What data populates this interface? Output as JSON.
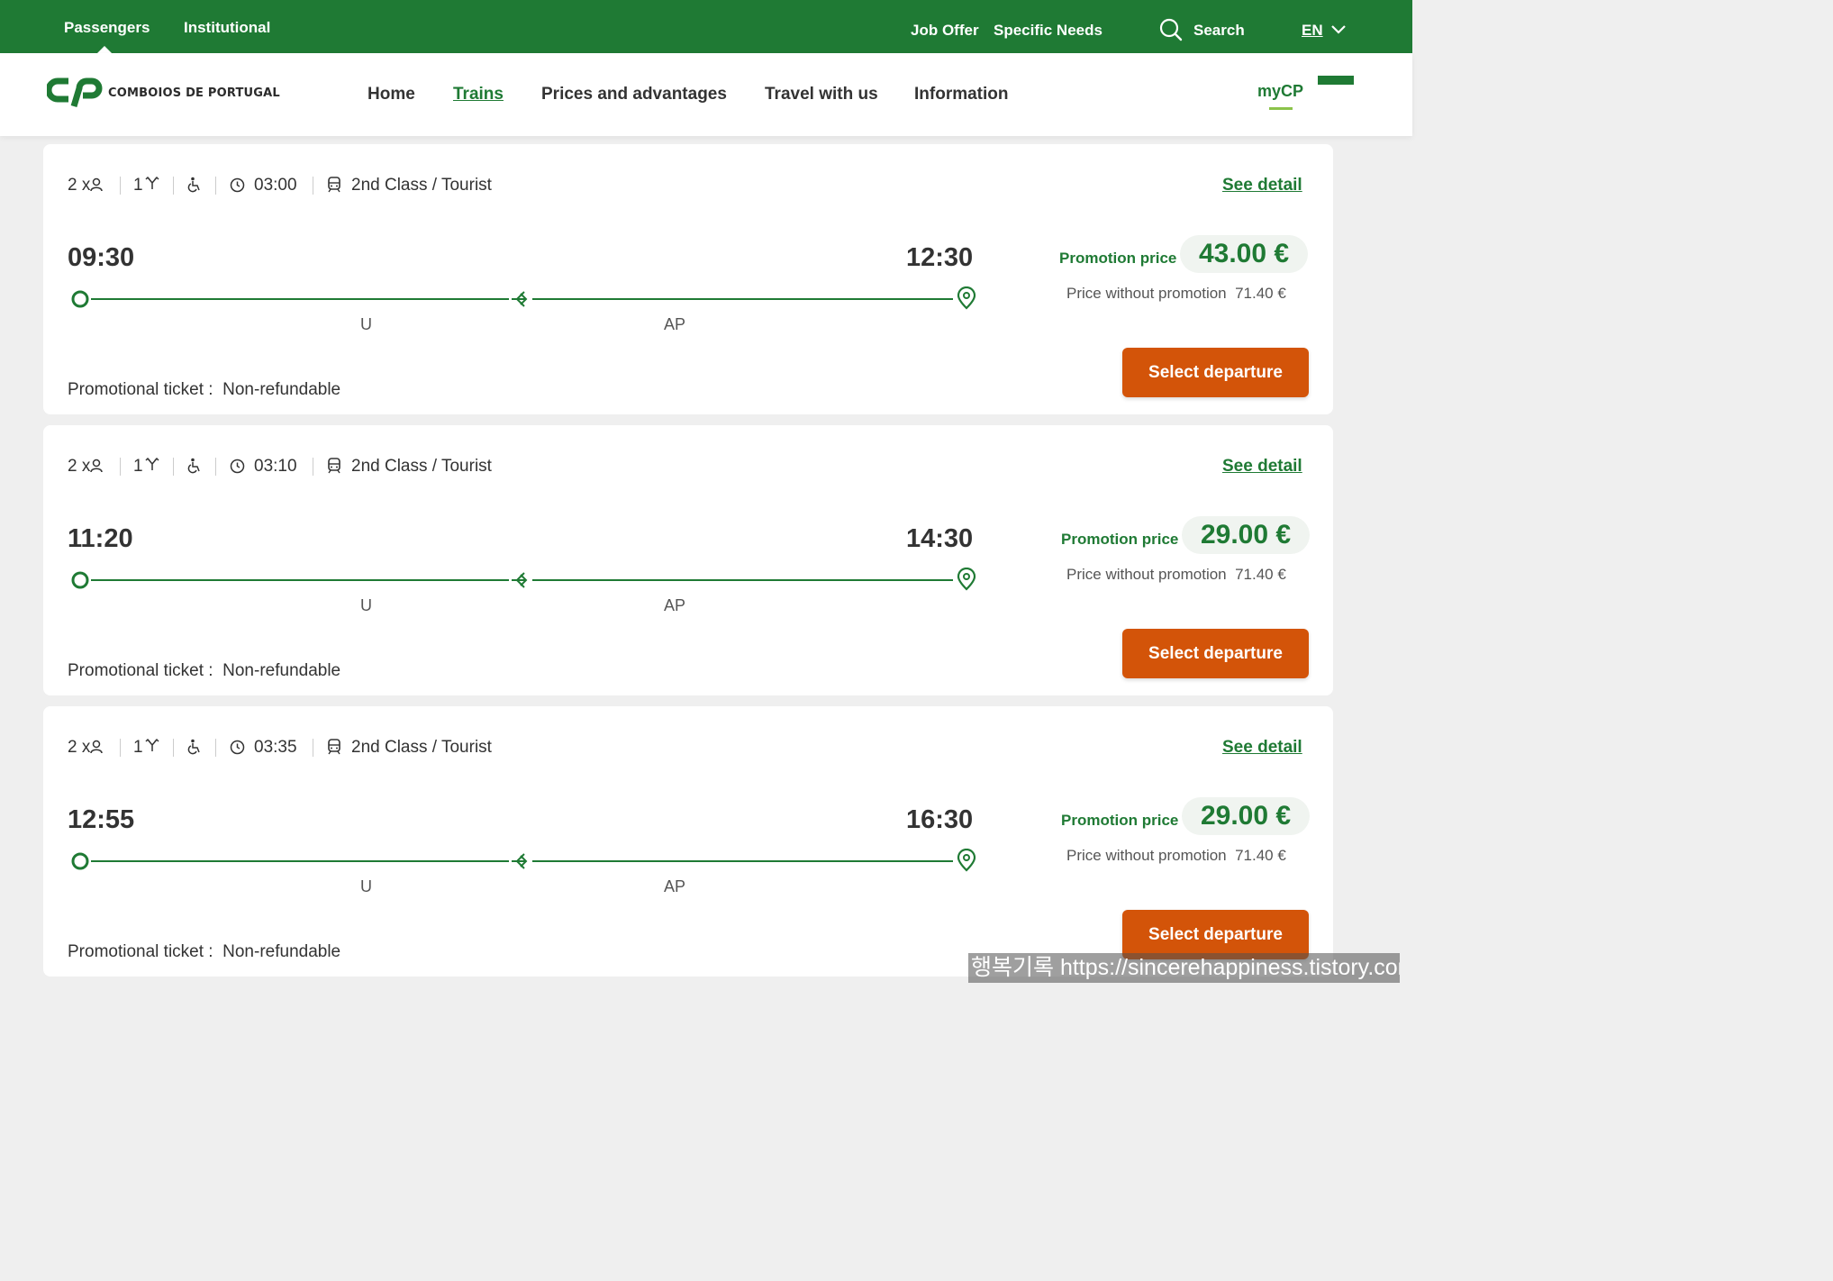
{
  "topbar": {
    "passengers": "Passengers",
    "institutional": "Institutional",
    "job_offer": "Job Offer",
    "specific_needs": "Specific Needs",
    "search": "Search",
    "language": "EN"
  },
  "brand": {
    "name": "COMBOIOS DE PORTUGAL",
    "color": "#1f7a34",
    "accent": "#d35409"
  },
  "nav": {
    "items": [
      {
        "label": "Home"
      },
      {
        "label": "Trains"
      },
      {
        "label": "Prices and advantages"
      },
      {
        "label": "Travel with us"
      },
      {
        "label": "Information"
      }
    ],
    "active": "Trains",
    "mycp": "myCP"
  },
  "results": [
    {
      "passengers": "2 x",
      "transfers": "1",
      "duration": "03:00",
      "class": "2nd Class / Tourist",
      "see_detail": "See detail",
      "departure": "09:30",
      "arrival": "12:30",
      "stops": [
        "U",
        "AP"
      ],
      "promo_label": "Promotion price",
      "promo_price": "43.00 €",
      "no_promo_label": "Price without promotion",
      "no_promo_price": "71.40 €",
      "select_label": "Select departure",
      "ticket_label": "Promotional ticket :",
      "ticket_value": "Non-refundable"
    },
    {
      "passengers": "2 x",
      "transfers": "1",
      "duration": "03:10",
      "class": "2nd Class / Tourist",
      "see_detail": "See detail",
      "departure": "11:20",
      "arrival": "14:30",
      "stops": [
        "U",
        "AP"
      ],
      "promo_label": "Promotion price",
      "promo_price": "29.00 €",
      "no_promo_label": "Price without promotion",
      "no_promo_price": "71.40 €",
      "select_label": "Select departure",
      "ticket_label": "Promotional ticket :",
      "ticket_value": "Non-refundable"
    },
    {
      "passengers": "2 x",
      "transfers": "1",
      "duration": "03:35",
      "class": "2nd Class / Tourist",
      "see_detail": "See detail",
      "departure": "12:55",
      "arrival": "16:30",
      "stops": [
        "U",
        "AP"
      ],
      "promo_label": "Promotion price",
      "promo_price": "29.00 €",
      "no_promo_label": "Price without promotion",
      "no_promo_price": "71.40 €",
      "select_label": "Select departure",
      "ticket_label": "Promotional ticket :",
      "ticket_value": "Non-refundable"
    }
  ],
  "watermark": "행복기록 https://sincerehappiness.tistory.com"
}
